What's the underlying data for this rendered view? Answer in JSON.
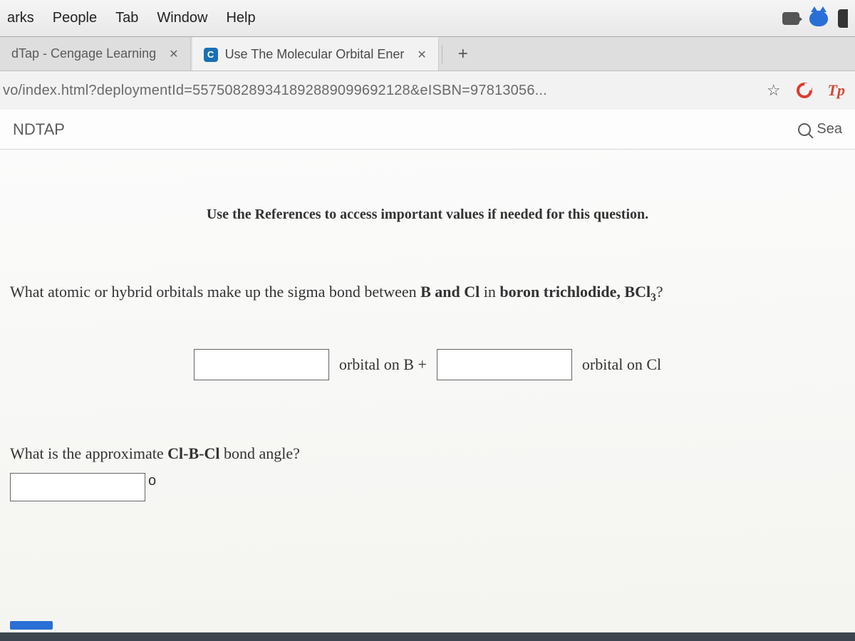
{
  "menubar": {
    "items": [
      "arks",
      "People",
      "Tab",
      "Window",
      "Help"
    ]
  },
  "tabs": [
    {
      "favicon_letter": "",
      "title": "dTap - Cengage Learning",
      "active": false
    },
    {
      "favicon_letter": "C",
      "title": "Use The Molecular Orbital Ener",
      "active": true
    }
  ],
  "new_tab_label": "+",
  "url": "vo/index.html?deploymentId=557508289341892889099692128&eISBN=97813056...",
  "tp_label": "Tp",
  "app": {
    "title": "NDTAP",
    "search_label": "Sea"
  },
  "content": {
    "references_note": "Use the References to access important values if needed for this question.",
    "q1_prefix": "What atomic or hybrid orbitals make up the sigma bond between ",
    "q1_bold1": "B and Cl",
    "q1_mid": " in ",
    "q1_bold2": "boron trichlodide, BCl",
    "q1_sub": "3",
    "q1_suffix": "?",
    "label_orbital_b": "orbital on B +",
    "label_orbital_cl": "orbital on Cl",
    "q2_text_prefix": "What is the approximate ",
    "q2_text_bold": "Cl-B-Cl",
    "q2_text_suffix": " bond angle?",
    "degree_symbol": "o",
    "input_b_value": "",
    "input_cl_value": "",
    "input_angle_value": ""
  }
}
